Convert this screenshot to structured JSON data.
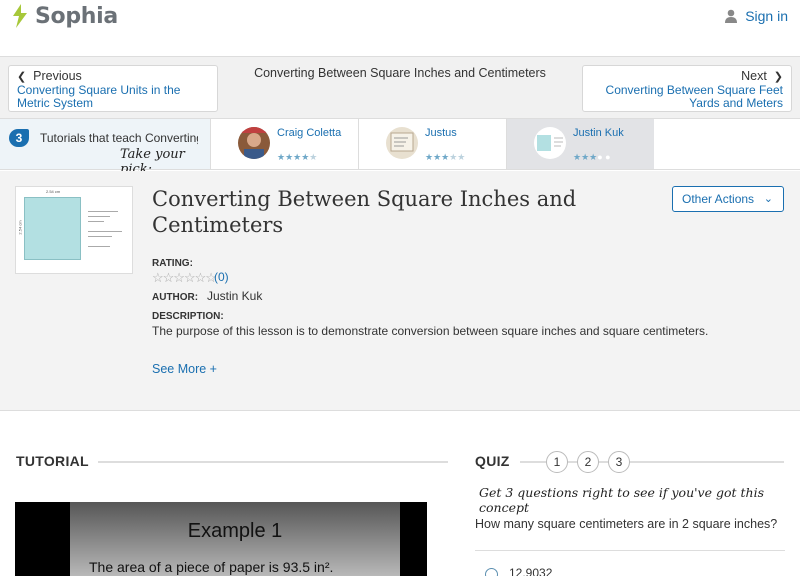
{
  "header": {
    "brand": "Sophia",
    "signin": "Sign in"
  },
  "nav": {
    "previous_label": "Previous",
    "previous_link": "Converting Square Units in the Metric System",
    "center_title": "Converting Between Square Inches and Centimeters",
    "next_label": "Next",
    "next_link": "Converting Between Square Feet Yards and Meters"
  },
  "picker": {
    "count": "3",
    "label": "Tutorials that teach Converting Between Square Inches and Centimeters",
    "hand": "Take your pick:",
    "tutorials": [
      {
        "name": "Craig Coletta",
        "rating": 4
      },
      {
        "name": "Justus",
        "rating": 3
      },
      {
        "name": "Justin Kuk",
        "rating": 3
      }
    ]
  },
  "overview": {
    "title": "Converting Between Square Inches and Centimeters",
    "other_actions": "Other Actions",
    "rating_label": "RATING:",
    "rating_count": "(0)",
    "author_label": "AUTHOR:",
    "author": "Justin Kuk",
    "description_label": "DESCRIPTION:",
    "description": "The purpose of this lesson is to demonstrate conversion between square inches and square centimeters.",
    "see_more": "See More +",
    "thumb_top": "2.54 cm",
    "thumb_side": "2.54 cm"
  },
  "tutorial": {
    "heading": "TUTORIAL",
    "slide_title": "Example 1",
    "slide_text": "The area of a piece of paper is 93.5 in²."
  },
  "quiz": {
    "heading": "QUIZ",
    "numbers": [
      "1",
      "2",
      "3"
    ],
    "hint": "Get 3 questions right to see if you've got this concept",
    "question": "How many square centimeters are in 2 square inches?",
    "answer1": "12.9032"
  }
}
